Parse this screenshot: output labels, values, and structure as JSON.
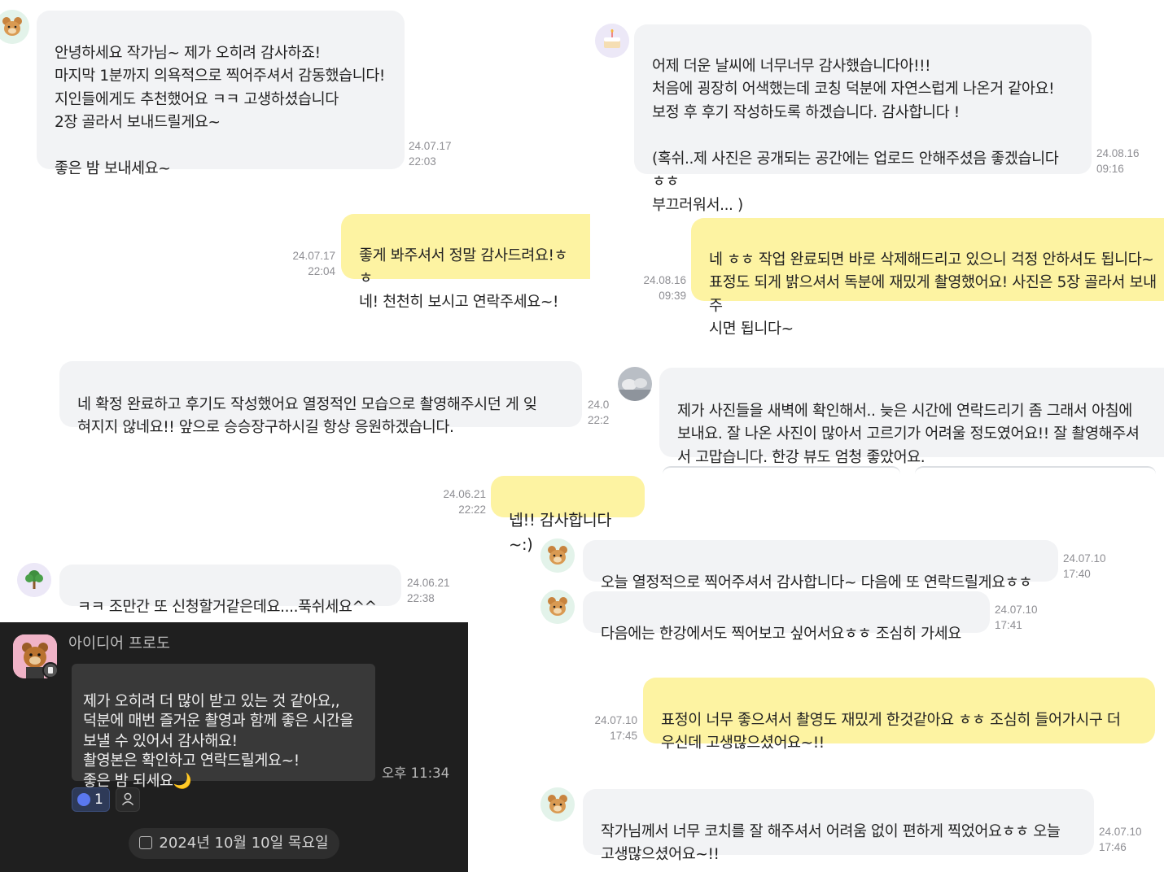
{
  "messages": {
    "m1": {
      "text": "안녕하세요 작가님~ 제가 오히려 감사하죠!\n마지막 1분까지 의욕적으로 찍어주셔서 감동했습니다!\n지인들에게도 추천했어요 ㅋㅋ 고생하셨습니다\n2장 골라서 보내드릴게요~\n\n좋은 밤 보내세요~",
      "time": "24.07.17\n22:03"
    },
    "m2": {
      "text": "좋게 봐주셔서 정말 감사드려요!ㅎㅎ\n네! 천천히 보시고 연락주세요~!",
      "time": "24.07.17\n22:04"
    },
    "m3": {
      "text": "어제 더운 날씨에 너무너무 감사했습니다아!!!\n처음에 굉장히 어색했는데 코칭 덕분에 자연스럽게 나온거 같아요!\n보정 후 후기 작성하도록 하겠습니다. 감사합니다 !\n\n(혹쉬..제 사진은 공개되는 공간에는 업로드 안해주셨음 좋겠습니다 ㅎㅎ\n부끄러워서... )",
      "time": "24.08.16\n09:16"
    },
    "m4": {
      "text": "네 ㅎㅎ 작업 완료되면 바로 삭제해드리고 있으니 걱정 안하셔도 됩니다~\n표정도 되게 밝으셔서 독분에 재밌게 촬영했어요! 사진은 5장 골라서 보내주\n시면 됩니다~",
      "time": "24.08.16\n09:39"
    },
    "m5": {
      "text": "네 확정 완료하고 후기도 작성했어요 열정적인 모습으로 촬영해주시던 게 잊\n혀지지 않네요!! 앞으로 승승장구하시길 항상 응원하겠습니다.",
      "time": "24.0\n22:2"
    },
    "m6": {
      "text": "제가 사진들을 새벽에 확인해서.. 늦은 시간에 연락드리기 좀 그래서 아침에\n보내요. 잘 나온 사진이 많아서 고르기가 어려울 정도였어요!! 잘 촬영해주셔\n서 고맙습니다. 한강 뷰도 엄청 좋았어요."
    },
    "m7": {
      "text": "넵!! 감사합니다~:)",
      "time": "24.06.21\n22:22"
    },
    "m8": {
      "text": "오늘 열정적으로 찍어주셔서 감사합니다~ 다음에 또 연락드릴게요ㅎㅎ",
      "time": "24.07.10\n17:40"
    },
    "m9": {
      "text": "ㅋㅋ 조만간 또 신청할거같은데요....푹쉬세요^^",
      "time": "24.06.21\n22:38"
    },
    "m10": {
      "text": "다음에는 한강에서도 찍어보고 싶어서요ㅎㅎ 조심히 가세요",
      "time": "24.07.10\n17:41"
    },
    "m11": {
      "text": "표정이 너무 좋으셔서 촬영도 재밌게 한것같아요 ㅎㅎ 조심히 들어가시구 더\n우신데 고생많으셨어요~!!",
      "time": "24.07.10\n17:45"
    },
    "m12": {
      "text": "작가님께서 너무 코치를 잘 해주셔서 어려움 없이 편하게 찍었어요ㅎㅎ 오늘\n고생많으셨어요~!!",
      "time": "24.07.10\n17:46"
    }
  },
  "dark_chat": {
    "sender": "아이디어 프로도",
    "text": "제가 오히려 더 많이 받고 있는 것 같아요,,\n덕분에 매번 즐거운 촬영과 함께 좋은 시간을\n보낼 수 있어서 감사해요!\n촬영본은 확인하고 연락드릴게요~!\n좋은 밤 되세요",
    "moon": "🌙",
    "time": "오후 11:34",
    "reaction_count": "1",
    "date": "2024년 10월 10일 목요일"
  },
  "icons": {
    "avatar": "bear-avatar-icon",
    "cake": "cake-avatar-icon",
    "tree": "tree-avatar-icon",
    "photo": "photo-avatar-icon",
    "thumb": "thumbs-up-icon",
    "person": "person-icon",
    "calendar": "calendar-icon"
  },
  "colors": {
    "gray_bubble": "#f2f3f5",
    "yellow_bubble": "#fdf3a2",
    "dark_bg": "#1f1f1f"
  }
}
